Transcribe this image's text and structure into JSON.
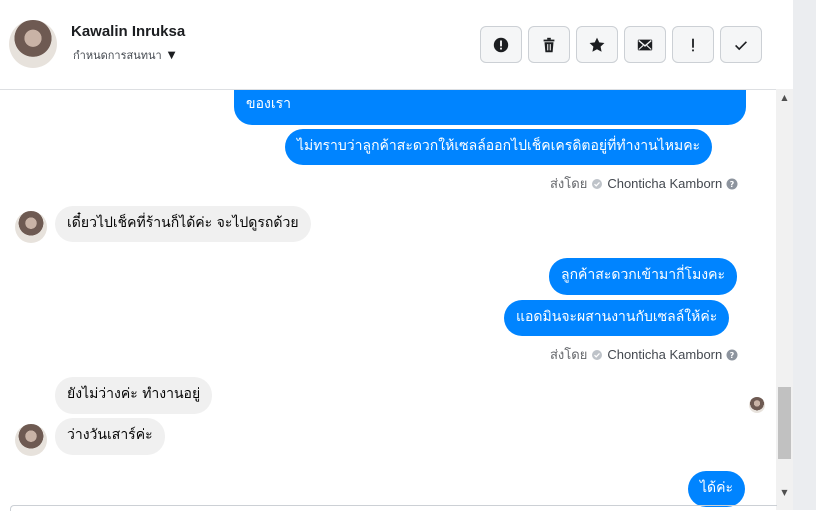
{
  "header": {
    "contact_name": "Kawalin Inruksa",
    "subtitle": "กำหนดการสนทนา",
    "actions": [
      {
        "name": "report-icon"
      },
      {
        "name": "trash-icon"
      },
      {
        "name": "star-icon"
      },
      {
        "name": "envelope-icon"
      },
      {
        "name": "exclamation-icon"
      },
      {
        "name": "check-icon"
      }
    ]
  },
  "messages": {
    "m1": "ของเรา",
    "m2": "ไม่ทราบว่าลูกค้าสะดวกให้เซลล์ออกไปเช็คเครดิตอยู่ที่ทำงานไหมคะ",
    "sent_by_1": {
      "prefix": "ส่งโดย",
      "agent": "Chonticha Kamborn"
    },
    "m3": "เดี๋ยวไปเช็คที่ร้านก็ได้ค่ะ จะไปดูรถด้วย",
    "m4": "ลูกค้าสะดวกเข้ามากี่โมงคะ",
    "m5": "แอดมินจะผสานงานกับเซลล์ให้ค่ะ",
    "sent_by_2": {
      "prefix": "ส่งโดย",
      "agent": "Chonticha Kamborn"
    },
    "m6": "ยังไม่ว่างค่ะ ทำงานอยู่",
    "m7": "ว่างวันเสาร์ค่ะ",
    "m8": "ได้ค่ะ"
  },
  "colors": {
    "outgoing_bubble": "#0084ff",
    "incoming_bubble": "#f0f0f0"
  }
}
